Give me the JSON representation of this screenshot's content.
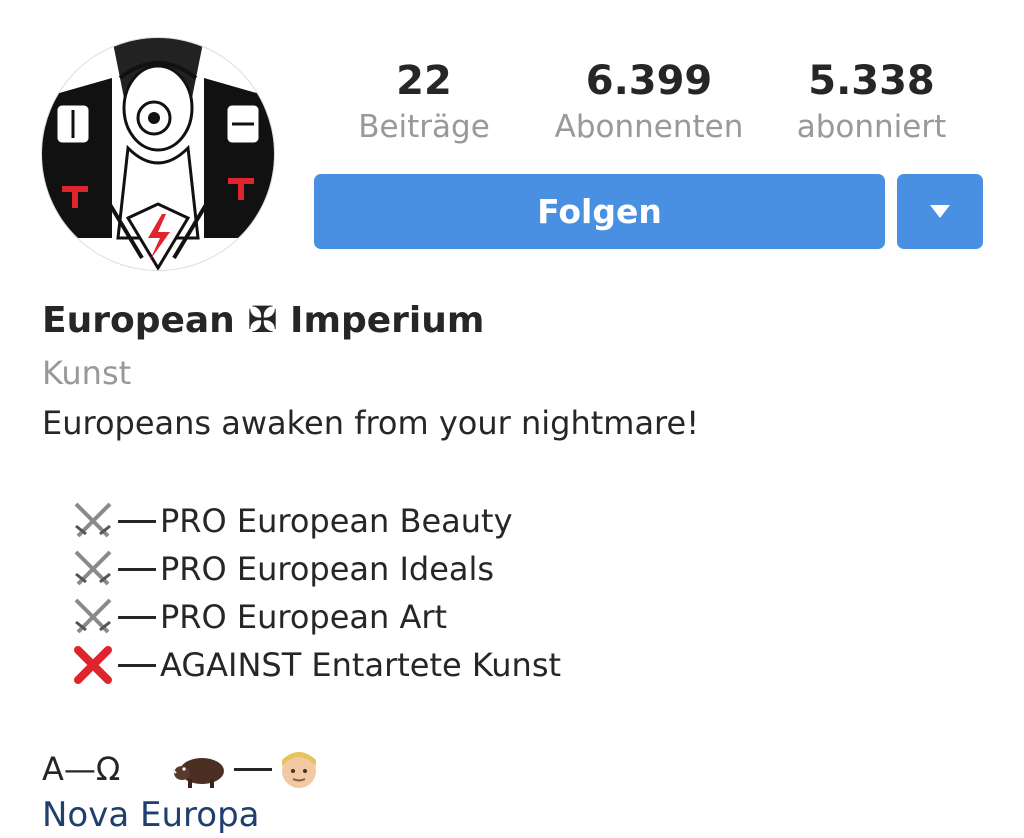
{
  "profile": {
    "name": "European ✠ Imperium",
    "category": "Kunst",
    "tagline": "Europeans awaken from your nightmare!",
    "bio_items": [
      {
        "icon": "crossed-swords-icon",
        "text": "PRO European Beauty"
      },
      {
        "icon": "crossed-swords-icon",
        "text": "PRO European Ideals"
      },
      {
        "icon": "crossed-swords-icon",
        "text": "PRO European Art"
      },
      {
        "icon": "cross-mark-icon",
        "text": "AGAINST Entartete Kunst"
      }
    ],
    "bottom_line": {
      "text": "A—Ω",
      "icons": [
        "boar-icon",
        "person-face-icon"
      ]
    },
    "link": "Nova Europa"
  },
  "stats": {
    "posts": {
      "value": "22",
      "label": "Beiträge"
    },
    "followers": {
      "value": "6.399",
      "label": "Abonnenten"
    },
    "following": {
      "value": "5.338",
      "label": "abonniert"
    }
  },
  "actions": {
    "follow_label": "Folgen"
  },
  "colors": {
    "accent": "#4a90e2",
    "text": "#262626",
    "muted": "#999999",
    "link": "#1f3f6e",
    "cross": "#e0242d"
  }
}
